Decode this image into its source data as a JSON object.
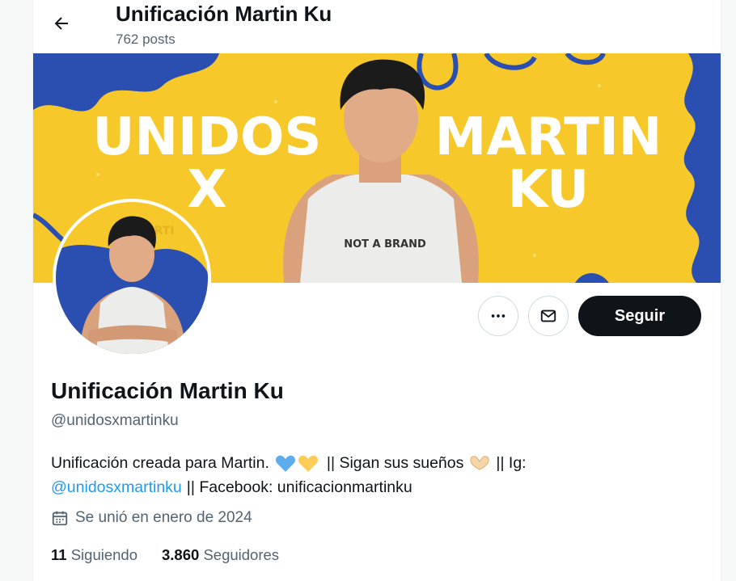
{
  "header": {
    "title": "Unificación Martin Ku",
    "post_count": "762 posts",
    "back_icon": "arrow-left-icon"
  },
  "banner": {
    "left_text_line1": "UNIDOS",
    "left_text_line2": "X",
    "right_text_line1": "MARTIN",
    "right_text_line2": "KU",
    "shirt_text": "NOT A BRAND",
    "background_color": "#f7c829",
    "accent_color": "#2a4fb0"
  },
  "avatar": {
    "bg_text": "KU MARTI"
  },
  "actions": {
    "more_icon": "more-horizontal-icon",
    "message_icon": "envelope-icon",
    "follow_label": "Seguir"
  },
  "profile": {
    "name": "Unificación Martin Ku",
    "handle": "@unidosxmartinku",
    "bio_part1": "Unificación creada para Martin.",
    "bio_part2": "|| Sigan sus sueños",
    "bio_part3": "|| Ig:",
    "bio_link": "@unidosxmartinku",
    "bio_part4": "|| Facebook: unificacionmartinku",
    "joined": "Se unió en enero de 2024",
    "joined_icon": "calendar-icon"
  },
  "stats": {
    "following_count": "11",
    "following_label": "Siguiendo",
    "followers_count": "3.860",
    "followers_label": "Seguidores"
  },
  "colors": {
    "accent": "#1d9bf0",
    "text": "#0f1419",
    "secondary": "#536471"
  }
}
